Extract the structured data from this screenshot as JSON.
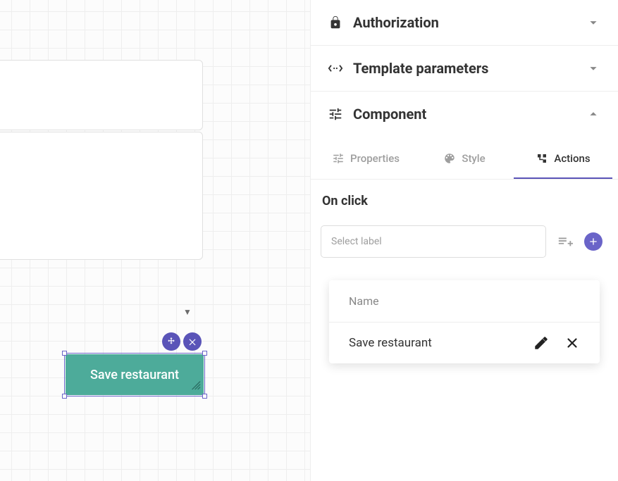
{
  "canvas": {
    "button_label": "Save restaurant"
  },
  "panel": {
    "sections": {
      "authorization": {
        "title": "Authorization"
      },
      "template_params": {
        "title": "Template parameters"
      },
      "component": {
        "title": "Component"
      }
    },
    "tabs": {
      "properties": "Properties",
      "style": "Style",
      "actions": "Actions"
    },
    "actions": {
      "event_title": "On click",
      "select_placeholder": "Select label",
      "card": {
        "header": "Name",
        "items": [
          {
            "label": "Save restaurant"
          }
        ]
      }
    }
  }
}
